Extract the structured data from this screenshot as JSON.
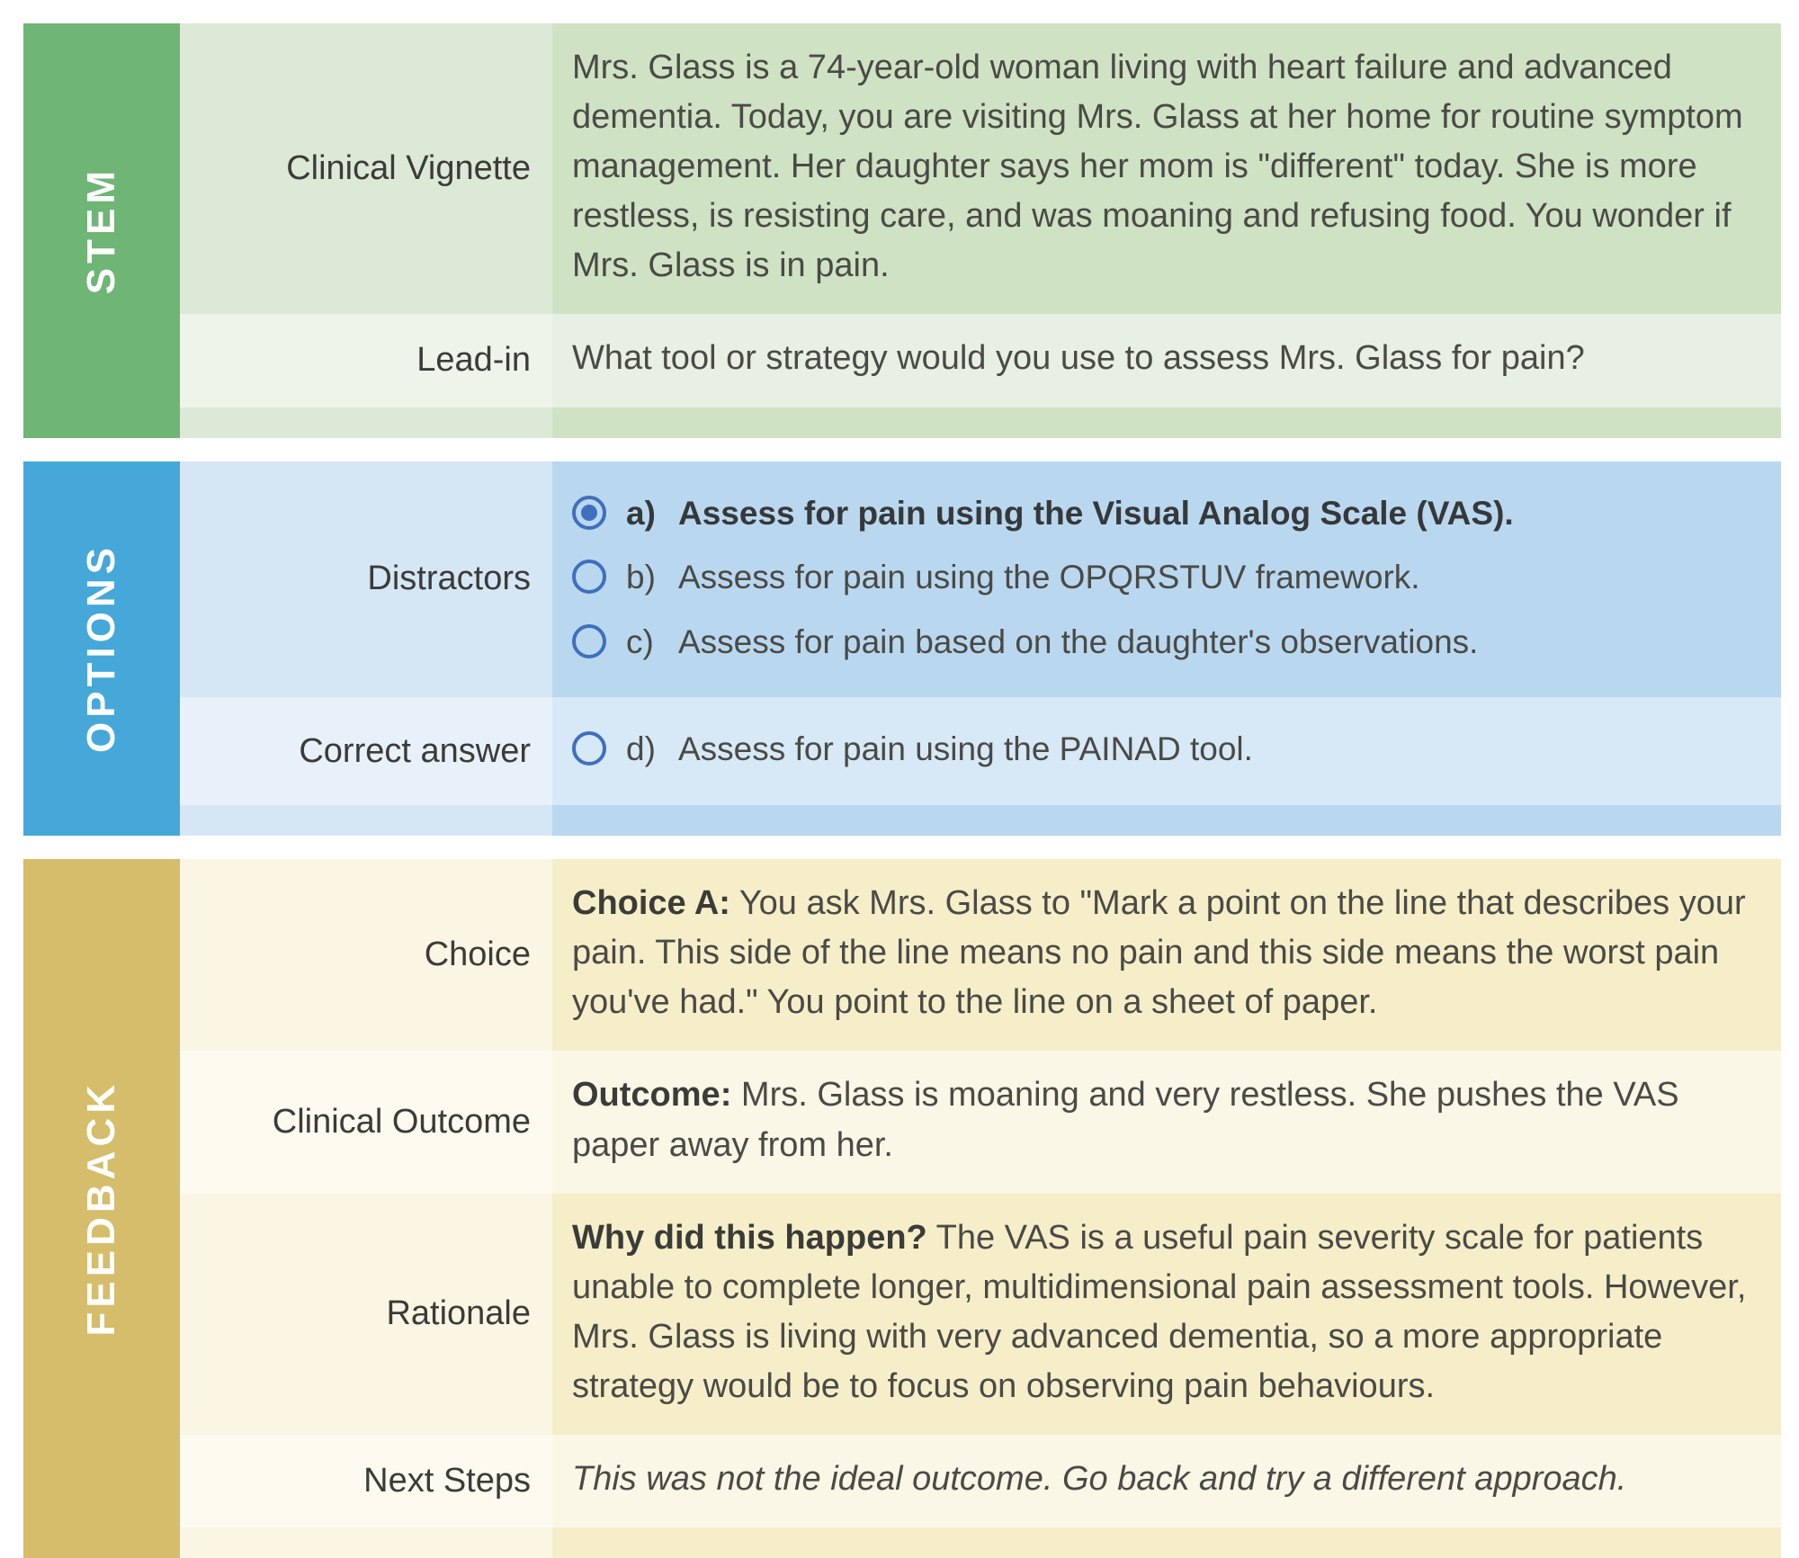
{
  "colors": {
    "stem_accent": "#6fb575",
    "options_accent": "#45a8d9",
    "feedback_accent": "#d5bd6b",
    "radio_blue": "#3f6fbd",
    "text": "#4a4a46"
  },
  "sections": {
    "stem": {
      "tab_label": "STEM",
      "rows": [
        {
          "label": "Clinical Vignette",
          "text": "Mrs. Glass is a 74-year-old woman living with heart failure and advanced dementia. Today, you are visiting Mrs. Glass at her home for routine symptom management. Her daughter says her mom is \"different\" today. She is more restless, is resisting care, and was moaning and refusing food. You wonder if Mrs. Glass is in pain."
        },
        {
          "label": "Lead-in",
          "text": "What tool or strategy would you use to assess Mrs. Glass for pain?"
        }
      ]
    },
    "options": {
      "tab_label": "OPTIONS",
      "distractors_label": "Distractors",
      "correct_label": "Correct answer",
      "choices": [
        {
          "letter": "a)",
          "text": "Assess for pain using the Visual Analog Scale (VAS).",
          "selected": true
        },
        {
          "letter": "b)",
          "text": "Assess for pain using the OPQRSTUV framework.",
          "selected": false
        },
        {
          "letter": "c)",
          "text": "Assess for pain based on the daughter's observations.",
          "selected": false
        },
        {
          "letter": "d)",
          "text": "Assess for pain using the PAINAD tool.",
          "selected": false
        }
      ]
    },
    "feedback": {
      "tab_label": "FEEDBACK",
      "rows": [
        {
          "label": "Choice",
          "lead": "Choice A:",
          "text": " You ask Mrs. Glass to \"Mark a point on the line that describes your pain. This side of the line means no pain and this side means the worst pain you've had.\" You point to the line on a sheet of paper."
        },
        {
          "label": "Clinical Outcome",
          "lead": "Outcome:",
          "text": " Mrs. Glass is moaning and very restless. She pushes the VAS paper away from her."
        },
        {
          "label": "Rationale",
          "lead": "Why did this happen?",
          "text": " The VAS is a useful pain severity scale for patients unable to complete longer, multidimensional pain assessment tools. However, Mrs. Glass is living with very advanced dementia, so a more appropriate strategy would be to focus on observing pain behaviours."
        },
        {
          "label": "Next Steps",
          "lead": "",
          "text": "This was not the ideal outcome. Go back and try a different approach."
        }
      ]
    }
  }
}
